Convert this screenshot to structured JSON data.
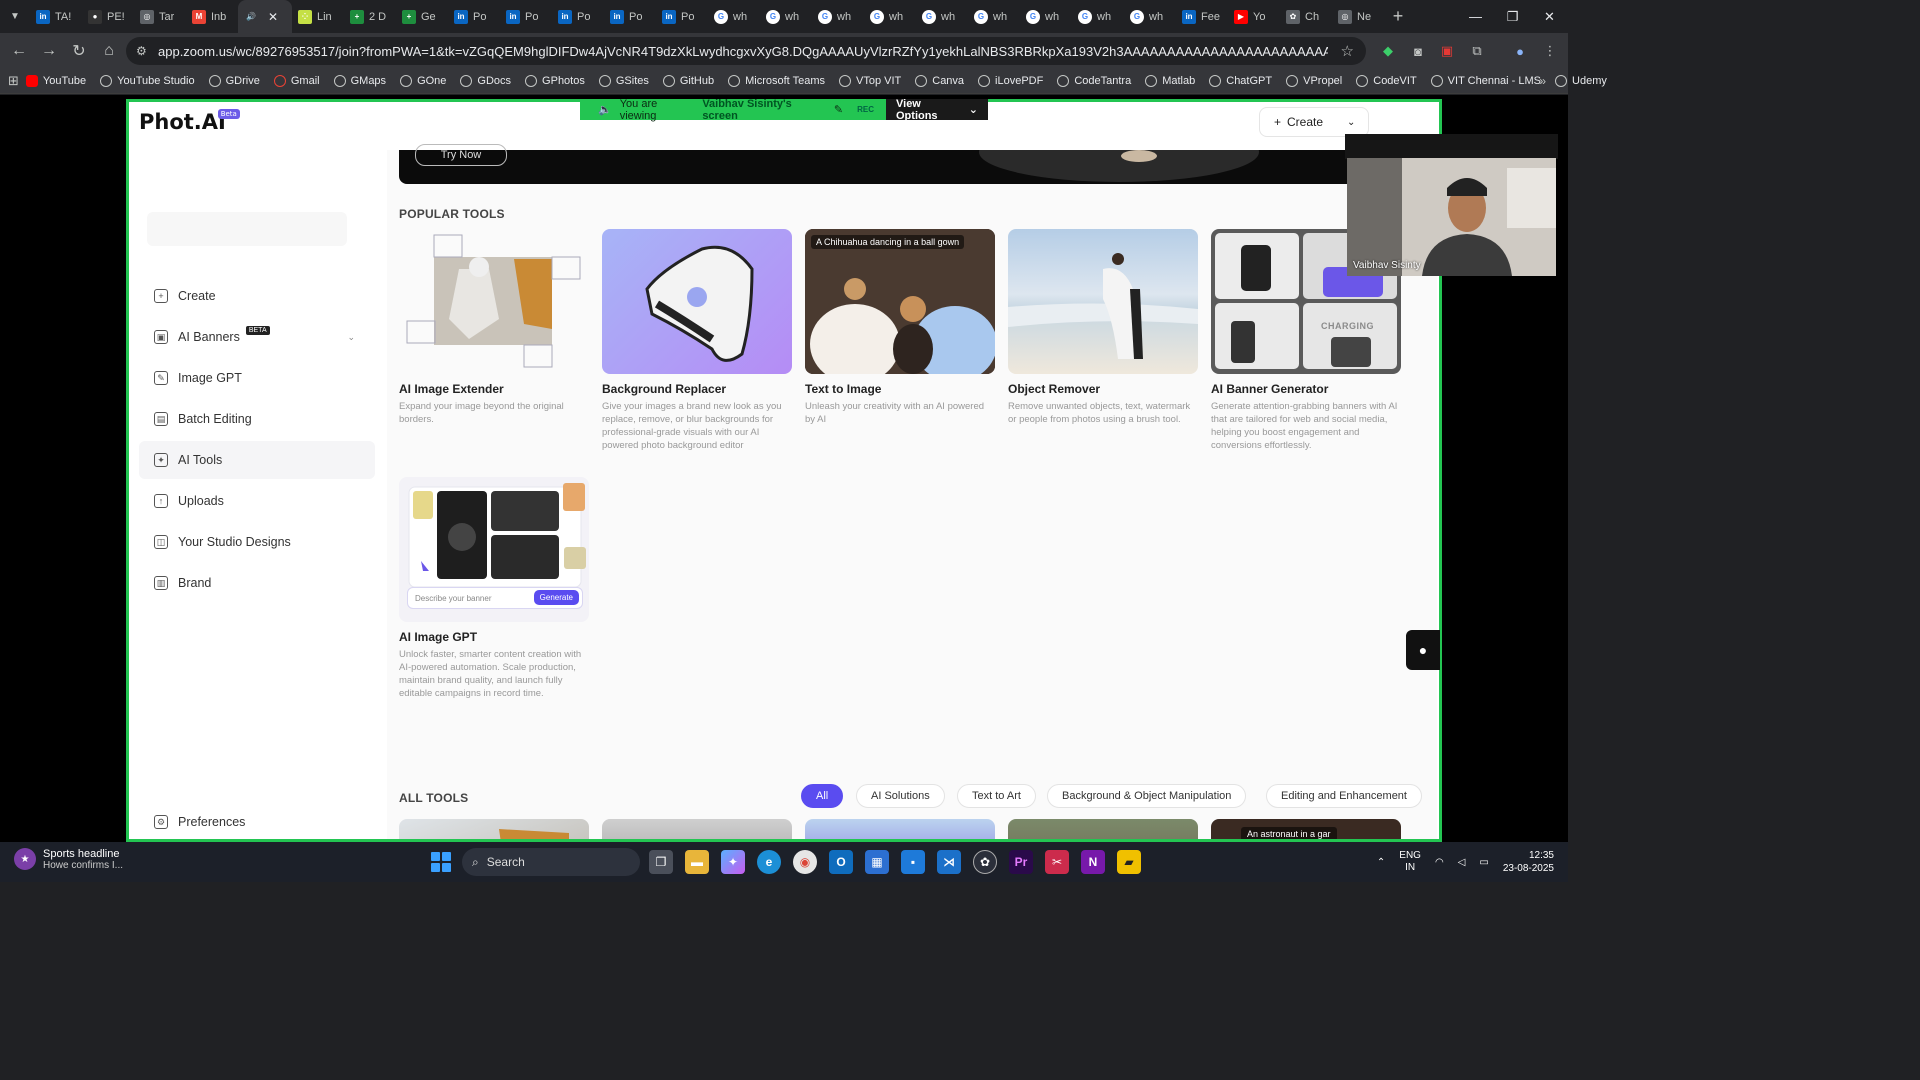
{
  "browser": {
    "tabs": [
      {
        "label": "TA!",
        "icon": "linkedin-icon",
        "color": "#0a66c2",
        "glyph": "in"
      },
      {
        "label": "PE!",
        "icon": "github-icon",
        "color": "#333333",
        "glyph": "●"
      },
      {
        "label": "Tar",
        "icon": "globe-icon",
        "color": "#5f6368",
        "glyph": "◎"
      },
      {
        "label": "Inb",
        "icon": "gmail-icon",
        "color": "#ea4335",
        "glyph": "M"
      },
      {
        "label": "",
        "icon": "speaker-icon",
        "color": "#35363a",
        "glyph": "🔊",
        "active": true
      },
      {
        "label": "Lin",
        "icon": "dots-icon",
        "color": "#c5e045",
        "glyph": "⁘"
      },
      {
        "label": "2 D",
        "icon": "sheets-icon",
        "color": "#1e8e3e",
        "glyph": "+"
      },
      {
        "label": "Ge",
        "icon": "sheets-icon",
        "color": "#1e8e3e",
        "glyph": "+"
      },
      {
        "label": "Po",
        "icon": "linkedin-icon",
        "color": "#0a66c2",
        "glyph": "in"
      },
      {
        "label": "Po",
        "icon": "linkedin-icon",
        "color": "#0a66c2",
        "glyph": "in"
      },
      {
        "label": "Po",
        "icon": "linkedin-icon",
        "color": "#0a66c2",
        "glyph": "in"
      },
      {
        "label": "Po",
        "icon": "linkedin-icon",
        "color": "#0a66c2",
        "glyph": "in"
      },
      {
        "label": "Po",
        "icon": "linkedin-icon",
        "color": "#0a66c2",
        "glyph": "in"
      },
      {
        "label": "wh",
        "icon": "google-icon",
        "color": "#ffffff",
        "glyph": "G"
      },
      {
        "label": "wh",
        "icon": "google-icon",
        "color": "#ffffff",
        "glyph": "G"
      },
      {
        "label": "wh",
        "icon": "google-icon",
        "color": "#ffffff",
        "glyph": "G"
      },
      {
        "label": "wh",
        "icon": "google-icon",
        "color": "#ffffff",
        "glyph": "G"
      },
      {
        "label": "wh",
        "icon": "google-icon",
        "color": "#ffffff",
        "glyph": "G"
      },
      {
        "label": "wh",
        "icon": "google-icon",
        "color": "#ffffff",
        "glyph": "G"
      },
      {
        "label": "wh",
        "icon": "google-icon",
        "color": "#ffffff",
        "glyph": "G"
      },
      {
        "label": "wh",
        "icon": "google-icon",
        "color": "#ffffff",
        "glyph": "G"
      },
      {
        "label": "wh",
        "icon": "google-icon",
        "color": "#ffffff",
        "glyph": "G"
      },
      {
        "label": "Fee",
        "icon": "linkedin-icon",
        "color": "#0a66c2",
        "glyph": "in"
      },
      {
        "label": "Yo",
        "icon": "youtube-icon",
        "color": "#ff0000",
        "glyph": "▶"
      },
      {
        "label": "Ch",
        "icon": "chatgpt-icon",
        "color": "#5f6368",
        "glyph": "✿"
      },
      {
        "label": "Ne",
        "icon": "globe-icon",
        "color": "#5f6368",
        "glyph": "◎"
      }
    ],
    "url": "app.zoom.us/wc/89276953517/join?fromPWA=1&tk=vZGqQEM9hglDIFDw4AjVcNR4T9dzXkLwydhcgxvXyG8.DQgAAAAUyVlzrRZfYy1yekhLalNBS3RBRkpXa193V2h3AAAAAAAAAAAAAAAAAAAAAAAAAAAAAAAAAAAAAAAAAAAA&_x_zm_r...",
    "bookmarks": [
      {
        "label": "YouTube",
        "kind": "yt"
      },
      {
        "label": "YouTube Studio",
        "kind": "globe"
      },
      {
        "label": "GDrive",
        "kind": "globe"
      },
      {
        "label": "Gmail",
        "kind": "gm"
      },
      {
        "label": "GMaps",
        "kind": "globe"
      },
      {
        "label": "GOne",
        "kind": "globe"
      },
      {
        "label": "GDocs",
        "kind": "globe"
      },
      {
        "label": "GPhotos",
        "kind": "globe"
      },
      {
        "label": "GSites",
        "kind": "globe"
      },
      {
        "label": "GitHub",
        "kind": "globe"
      },
      {
        "label": "Microsoft Teams",
        "kind": "globe"
      },
      {
        "label": "VTop VIT",
        "kind": "globe"
      },
      {
        "label": "Canva",
        "kind": "globe"
      },
      {
        "label": "iLovePDF",
        "kind": "globe"
      },
      {
        "label": "CodeTantra",
        "kind": "globe"
      },
      {
        "label": "Matlab",
        "kind": "globe"
      },
      {
        "label": "ChatGPT",
        "kind": "globe"
      },
      {
        "label": "VPropel",
        "kind": "globe"
      },
      {
        "label": "CodeVIT",
        "kind": "globe"
      },
      {
        "label": "VIT Chennai - LMS",
        "kind": "globe"
      },
      {
        "label": "Udemy",
        "kind": "globe"
      }
    ]
  },
  "zoom": {
    "banner_prefix": "You are viewing",
    "banner_name": "Vaibhav Sisinty's screen",
    "rec": "REC",
    "view_options": "View Options",
    "participant_name": "Vaibhav Sisinty",
    "accent": "#23c552"
  },
  "app": {
    "logo": "Phot.AI",
    "logo_badge": "Beta",
    "create_button": "Create",
    "hero_button": "Try Now",
    "sidebar": [
      {
        "label": "Create",
        "icon": "plus-circle-icon",
        "glyph": "+"
      },
      {
        "label": "AI Banners",
        "icon": "banner-icon",
        "glyph": "▣",
        "badge": "BETA",
        "chevron": true
      },
      {
        "label": "Image GPT",
        "icon": "image-gpt-icon",
        "glyph": "✎"
      },
      {
        "label": "Batch Editing",
        "icon": "batch-icon",
        "glyph": "▤"
      },
      {
        "label": "AI Tools",
        "icon": "sparkle-icon",
        "glyph": "✦",
        "active": true
      },
      {
        "label": "Uploads",
        "icon": "upload-icon",
        "glyph": "↑"
      },
      {
        "label": "Your Studio Designs",
        "icon": "studio-icon",
        "glyph": "◫"
      },
      {
        "label": "Brand",
        "icon": "brand-icon",
        "glyph": "▥"
      }
    ],
    "preferences": "Preferences",
    "popular_title": "POPULAR TOOLS",
    "popular_tools": [
      {
        "title": "AI Image Extender",
        "desc": "Expand your image beyond the original borders."
      },
      {
        "title": "Background Replacer",
        "desc": "Give your images a brand new look as you replace, remove, or blur backgrounds for professional-grade visuals with our AI powered photo background editor"
      },
      {
        "title": "Text to Image",
        "desc": "Unleash your creativity with an AI powered by AI",
        "overlay": "A Chihuahua dancing in a ball gown"
      },
      {
        "title": "Object Remover",
        "desc": "Remove unwanted objects, text, watermark or people from photos using a brush tool."
      },
      {
        "title": "AI Banner Generator",
        "desc": "Generate attention-grabbing banners with AI that are tailored for web and social media, helping you boost engagement and conversions effortlessly.",
        "overlay": "CHARGING"
      },
      {
        "title": "AI Image GPT",
        "desc": "Unlock faster, smarter content creation with AI-powered automation. Scale production, maintain brand quality, and launch fully editable campaigns in record time.",
        "prompt": "Describe your banner",
        "generate": "Generate"
      }
    ],
    "all_title": "ALL TOOLS",
    "filters": [
      "All",
      "AI Solutions",
      "Text to Art",
      "Background & Object Manipulation",
      "Editing and Enhancement"
    ],
    "all_tools_overlay": "An astronaut in a gar"
  },
  "taskbar": {
    "news_title": "Sports headline",
    "news_sub": "Howe confirms I...",
    "search": "Search",
    "lang1": "ENG",
    "lang2": "IN",
    "time": "12:35",
    "date": "23-08-2025"
  }
}
